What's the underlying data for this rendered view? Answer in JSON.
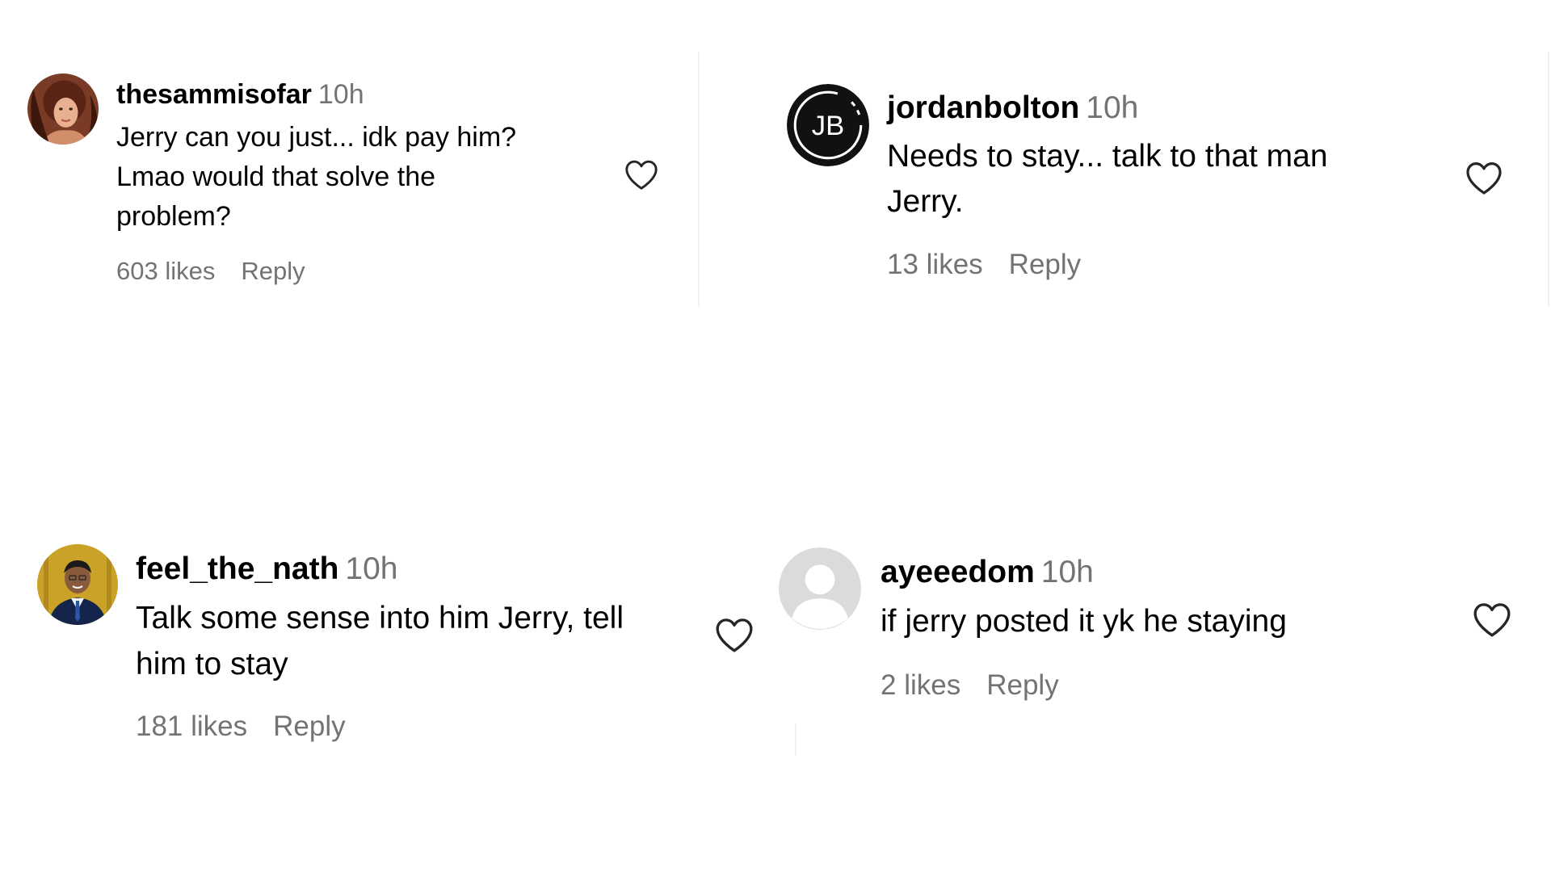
{
  "comments": [
    {
      "username": "thesammisofar",
      "time": "10h",
      "lines": [
        "Jerry can you just... idk pay him?",
        "Lmao would that solve the",
        "problem?"
      ],
      "likes": "603 likes",
      "reply": "Reply",
      "avatar_icon": "profile-photo-woman",
      "like_icon": "heart-outline-icon"
    },
    {
      "username": "jordanbolton",
      "time": "10h",
      "lines": [
        "Needs to stay... talk to that man",
        "Jerry."
      ],
      "likes": "13 likes",
      "reply": "Reply",
      "avatar_initials": "JB",
      "like_icon": "heart-outline-icon"
    },
    {
      "username": "feel_the_nath",
      "time": "10h",
      "lines": [
        "Talk some sense into him Jerry, tell",
        "him to stay"
      ],
      "likes": "181 likes",
      "reply": "Reply",
      "avatar_icon": "profile-photo-man-suit",
      "like_icon": "heart-outline-icon"
    },
    {
      "username": "ayeeedom",
      "time": "10h",
      "lines": [
        "if jerry posted it yk he staying"
      ],
      "likes": "2 likes",
      "reply": "Reply",
      "avatar_icon": "default-avatar-icon",
      "like_icon": "heart-outline-icon"
    }
  ],
  "colors": {
    "text": "#000000",
    "secondary": "#737373",
    "background": "#ffffff",
    "heart_stroke": "#262626"
  }
}
